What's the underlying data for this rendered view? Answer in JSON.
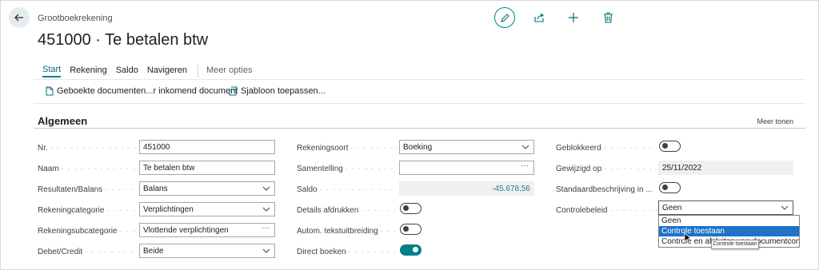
{
  "header": {
    "caption": "Grootboekrekening",
    "title": "451000 · Te betalen btw"
  },
  "tabs": {
    "items": [
      "Start",
      "Rekening",
      "Saldo",
      "Navigeren"
    ],
    "more": "Meer opties"
  },
  "commands": {
    "posted_docs": "Geboekte documenten...r inkomend document",
    "template": "Sjabloon toepassen..."
  },
  "section": {
    "title": "Algemeen",
    "show_more": "Meer tonen"
  },
  "col1": {
    "no_label": "Nr.",
    "no_value": "451000",
    "name_label": "Naam",
    "name_value": "Te betalen btw",
    "income_label": "Resultaten/Balans",
    "income_value": "Balans",
    "category_label": "Rekeningcategorie",
    "category_value": "Verplichtingen",
    "subcategory_label": "Rekeningsubcategorie",
    "subcategory_value": "Vlottende verplichtingen",
    "debitcredit_label": "Debet/Credit",
    "debitcredit_value": "Beide"
  },
  "col2": {
    "type_label": "Rekeningsoort",
    "type_value": "Boeking",
    "totaling_label": "Samentelling",
    "totaling_value": "",
    "balance_label": "Saldo",
    "balance_value": "-45.678,56",
    "print_details_label": "Details afdrukken",
    "print_details_on": false,
    "auto_text_label": "Autom. tekstuitbreiding",
    "auto_text_on": false,
    "direct_posting_label": "Direct boeken",
    "direct_posting_on": true
  },
  "col3": {
    "blocked_label": "Geblokkeerd",
    "blocked_on": false,
    "modified_label": "Gewijzigd op",
    "modified_value": "25/11/2022",
    "std_desc_label": "Standaardbeschrijving in ...",
    "std_desc_on": false,
    "control_label": "Controlebeleid",
    "control_value": "Geen"
  },
  "dropdown": {
    "options": [
      "Geen",
      "Controle toestaan",
      "Controle en afsluiten van documentcontrole toestaan"
    ],
    "option3_visible_tail": "do toestaan",
    "selected_index": 1,
    "tooltip": "Controle toestaan"
  },
  "colors": {
    "accent": "#008089",
    "selected": "#1e73c8"
  },
  "icons": [
    "back-arrow-icon",
    "pencil-icon",
    "share-icon",
    "plus-icon",
    "trash-icon",
    "document-icon",
    "template-icon",
    "chevron-down-icon",
    "cursor-icon"
  ]
}
